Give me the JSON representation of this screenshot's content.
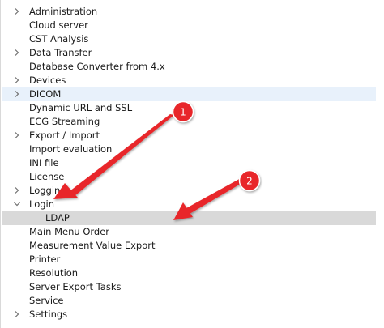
{
  "tree": {
    "items": [
      {
        "label": "Administration",
        "expander": "collapsed"
      },
      {
        "label": "Cloud server",
        "expander": "none"
      },
      {
        "label": "CST Analysis",
        "expander": "none"
      },
      {
        "label": "Data Transfer",
        "expander": "collapsed"
      },
      {
        "label": "Database Converter from 4.x",
        "expander": "none"
      },
      {
        "label": "Devices",
        "expander": "collapsed"
      },
      {
        "label": "DICOM",
        "expander": "collapsed",
        "state": "hovered"
      },
      {
        "label": "Dynamic URL and SSL",
        "expander": "none"
      },
      {
        "label": "ECG Streaming",
        "expander": "none"
      },
      {
        "label": "Export / Import",
        "expander": "collapsed"
      },
      {
        "label": "Import evaluation",
        "expander": "none"
      },
      {
        "label": "INI file",
        "expander": "none"
      },
      {
        "label": "License",
        "expander": "none"
      },
      {
        "label": "Logging",
        "expander": "collapsed"
      },
      {
        "label": "Login",
        "expander": "expanded"
      },
      {
        "label": "LDAP",
        "expander": "none",
        "state": "selected",
        "child": true
      },
      {
        "label": "Main Menu Order",
        "expander": "none"
      },
      {
        "label": "Measurement Value Export",
        "expander": "none"
      },
      {
        "label": "Printer",
        "expander": "none"
      },
      {
        "label": "Resolution",
        "expander": "none"
      },
      {
        "label": "Server Export Tasks",
        "expander": "none"
      },
      {
        "label": "Service",
        "expander": "none"
      },
      {
        "label": "Settings",
        "expander": "collapsed"
      }
    ]
  },
  "annotations": {
    "badges": [
      "1",
      "2"
    ],
    "color": "#e8282b"
  },
  "colors": {
    "hover": "#e8f1fb",
    "selected": "#d9d9d9",
    "text": "#1a1a1a",
    "chevron": "#707070"
  }
}
